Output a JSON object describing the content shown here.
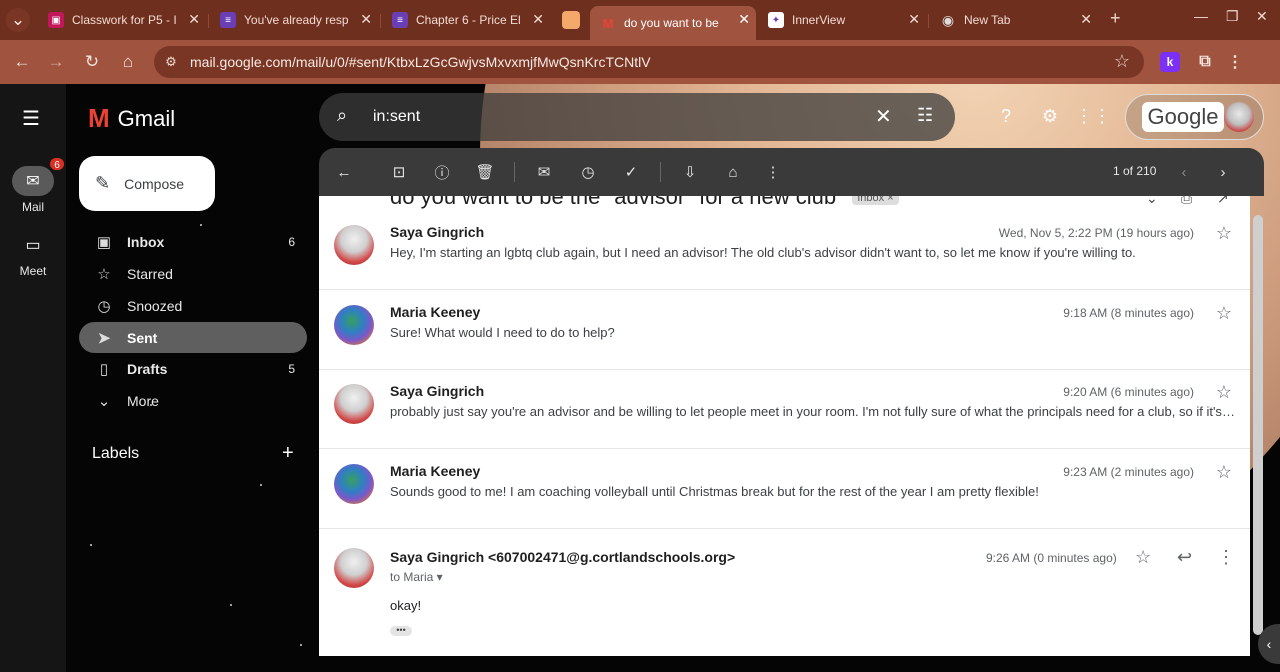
{
  "browser": {
    "tabs": [
      {
        "title": "Classwork for P5 - I",
        "icon": "google-classroom-icon",
        "color": "#c2185b"
      },
      {
        "title": "You've already resp",
        "icon": "google-forms-icon",
        "color": "#6a3fb5"
      },
      {
        "title": "Chapter 6 - Price El",
        "icon": "google-forms-icon",
        "color": "#6a3fb5"
      },
      {
        "title": "",
        "icon": "blank-tab-icon",
        "color": "#f4a86a"
      },
      {
        "title": "do you want to be t",
        "icon": "gmail-icon",
        "color": "#ea4335"
      },
      {
        "title": "InnerView",
        "icon": "innerview-icon",
        "color": "#6a3fb5"
      },
      {
        "title": "New Tab",
        "icon": "chrome-icon",
        "color": "#888888"
      }
    ],
    "url": "mail.google.com/mail/u/0/#sent/KtbxLzGcGwjvsMxvxmjfMwQsnKrcTCNtlV",
    "new_tab": "+",
    "ext_k": "k"
  },
  "rail": {
    "mail_label": "Mail",
    "mail_badge": "6",
    "meet_label": "Meet"
  },
  "gmail": {
    "logo_text": "Gmail",
    "compose": "Compose",
    "nav": [
      {
        "label": "Inbox",
        "count": "6",
        "icon": "inbox-icon"
      },
      {
        "label": "Starred",
        "count": "",
        "icon": "star-icon"
      },
      {
        "label": "Snoozed",
        "count": "",
        "icon": "clock-icon"
      },
      {
        "label": "Sent",
        "count": "",
        "icon": "send-icon"
      },
      {
        "label": "Drafts",
        "count": "5",
        "icon": "draft-icon"
      },
      {
        "label": "More",
        "count": "",
        "icon": "chevron-down-icon"
      }
    ],
    "labels_heading": "Labels",
    "search_query": "in:sent",
    "account_brand": "Google"
  },
  "toolbar": {
    "pager": "1 of 210"
  },
  "thread": {
    "subject": "do you want to be the \"advisor\" for a new club",
    "tag": "Inbox ×",
    "messages": [
      {
        "sender": "Saya Gingrich",
        "snippet": "Hey, I'm starting an lgbtq club again, but I need an advisor! The old club's advisor didn't want to, so let me know if you're willing to.",
        "date": "Wed, Nov 5, 2:22 PM (19 hours ago)",
        "avatar": "saya"
      },
      {
        "sender": "Maria Keeney",
        "snippet": "Sure! What would I need to do to help?",
        "date": "9:18 AM (8 minutes ago)",
        "avatar": "maria"
      },
      {
        "sender": "Saya Gingrich",
        "snippet": "probably just say you're an advisor and be willing to let people meet in your room. I'm not fully sure of what the principals need for a club, so if it's a...",
        "date": "9:20 AM (6 minutes ago)",
        "avatar": "saya"
      },
      {
        "sender": "Maria Keeney",
        "snippet": "Sounds good to me! I am coaching volleyball until Christmas break but for the rest of the year I am pretty flexible!",
        "date": "9:23 AM (2 minutes ago)",
        "avatar": "maria"
      }
    ],
    "last": {
      "sender": "Saya Gingrich",
      "email": "<607002471@g.cortlandschools.org>",
      "to": "to Maria ▾",
      "date": "9:26 AM (0 minutes ago)",
      "body": "okay!",
      "dots": "•••"
    }
  }
}
